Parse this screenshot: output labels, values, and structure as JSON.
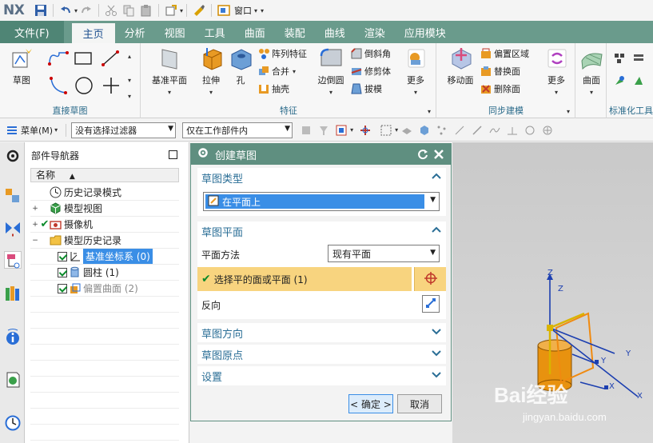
{
  "app": {
    "logo": "NX",
    "window_menu": "窗口"
  },
  "tabs": [
    "文件(F)",
    "主页",
    "分析",
    "视图",
    "工具",
    "曲面",
    "装配",
    "曲线",
    "渲染",
    "应用模块"
  ],
  "ribbon": {
    "sketch_group": {
      "label": "直接草图",
      "sketch": "草图"
    },
    "feature_group": {
      "label": "特征",
      "datum_plane": "基准平面",
      "extrude": "拉伸",
      "hole": "孔",
      "pattern": "阵列特征",
      "unite": "合并",
      "shell": "抽壳",
      "edge_blend": "边倒圆",
      "chamfer": "倒斜角",
      "trim_body": "修剪体",
      "draft": "拔模",
      "more": "更多"
    },
    "sync_group": {
      "label": "同步建模",
      "move_face": "移动面",
      "offset_region": "偏置区域",
      "replace_face": "替换面",
      "delete_face": "删除面",
      "more": "更多"
    },
    "surface_group": {
      "surface": "曲面"
    },
    "standard_group": {
      "label": "标准化工具"
    }
  },
  "selection_bar": {
    "menu": "菜单(M)",
    "filter": "没有选择过滤器",
    "scope": "仅在工作部件内"
  },
  "navigator": {
    "title": "部件导航器",
    "column": "名称",
    "items": [
      {
        "label": "历史记录模式",
        "icon": "clock-icon"
      },
      {
        "label": "模型视图",
        "icon": "model-views-icon"
      },
      {
        "label": "摄像机",
        "icon": "camera-icon"
      },
      {
        "label": "模型历史记录",
        "icon": "folder-icon"
      },
      {
        "label": "基准坐标系 (0)",
        "icon": "datum-csys-icon"
      },
      {
        "label": "圆柱 (1)",
        "icon": "cylinder-icon"
      },
      {
        "label": "偏置曲面 (2)",
        "icon": "offset-surface-icon"
      }
    ]
  },
  "dialog": {
    "title": "创建草图",
    "type_section": "草图类型",
    "type_value": "在平面上",
    "plane_section": "草图平面",
    "plane_method_label": "平面方法",
    "plane_method_value": "现有平面",
    "select_label": "选择平的面或平面 (1)",
    "reverse_label": "反向",
    "orientation_section": "草图方向",
    "origin_section": "草图原点",
    "settings_section": "设置",
    "ok": "< 确定 >",
    "cancel": "取消"
  },
  "graphics": {
    "axis_z": "Z",
    "axis_y": "Y",
    "axis_x": "X",
    "axis_zc": "Z",
    "axis_yc": "Y",
    "axis_xc": "X",
    "watermark": "Bai经验",
    "url": "jingyan.baidu.com"
  },
  "colors": {
    "tab_bar": "#6a9b8c",
    "dialog_title": "#5f8f80",
    "section_text": "#2a6e96",
    "selection_highlight": "#f8d47f"
  }
}
